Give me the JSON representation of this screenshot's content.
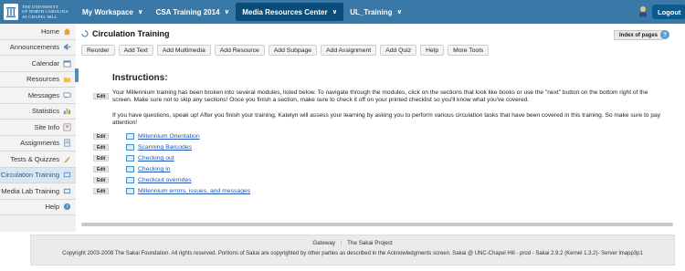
{
  "brand": {
    "line1": "The University",
    "line2": "of North Carolina",
    "line3": "at Chapel Hill"
  },
  "site_tabs": [
    {
      "label": "My Workspace"
    },
    {
      "label": "CSA Training 2014"
    },
    {
      "label": "Media Resources Center"
    },
    {
      "label": "UL_Training"
    }
  ],
  "logout_label": "Logout",
  "sidebar": {
    "items": [
      {
        "label": "Home",
        "icon": "home-icon"
      },
      {
        "label": "Announcements",
        "icon": "announcements-icon"
      },
      {
        "label": "Calendar",
        "icon": "calendar-icon"
      },
      {
        "label": "Resources",
        "icon": "folder-icon"
      },
      {
        "label": "Messages",
        "icon": "messages-icon"
      },
      {
        "label": "Statistics",
        "icon": "statistics-icon"
      },
      {
        "label": "Site Info",
        "icon": "site-info-icon"
      },
      {
        "label": "Assignments",
        "icon": "assignments-icon"
      },
      {
        "label": "Tests & Quizzes",
        "icon": "pencil-icon"
      },
      {
        "label": "Circulation Training",
        "icon": "book-icon"
      },
      {
        "label": "Media Lab Training",
        "icon": "book-icon"
      },
      {
        "label": "Help",
        "icon": "help-icon"
      }
    ]
  },
  "main": {
    "title": "Circulation Training",
    "index_label": "Index of pages",
    "help_symbol": "?",
    "toolbar": [
      "Reorder",
      "Add Text",
      "Add Multimedia",
      "Add Resource",
      "Add Subpage",
      "Add Assignment",
      "Add Quiz",
      "Help",
      "More Tools"
    ],
    "edit_label": "Edit",
    "instructions_title": "Instructions:",
    "para1": "Your Millennium training has been broken into several modules, listed below. To navigate through the modules, click on the sections that look like books or use the \"next\" button on the bottom right of the screen. Make sure not to skip any sections! Once you finish a section, make sure to check it off on your printed checklist so you'll know what you've covered.",
    "para2": "If you have questions, speak up! After you finish your training, Katelyn will assess your learning by asking you to perform various circulation tasks that have been covered in this training. So make sure to pay attention!",
    "modules": [
      "Millennium Orientation",
      "Scanning Barcodes",
      "Checking out",
      "Checking in",
      "Checkout overrides",
      "Millennium errors, issues, and messages"
    ]
  },
  "footer": {
    "links": [
      "Gateway",
      "The Sakai Project"
    ],
    "copyright": "Copyright 2003-2008 The Sakai Foundation. All rights reserved. Portions of Sakai are copyrighted by other parties as described in the Acknowledgments screen. Sakai @ UNC-Chapel Hill - prod - Sakai 2.9.2 (Kernel 1.3.2)- Server lmapp3p1"
  },
  "colors": {
    "topbar": "#3a78a8",
    "active_site_tab": "#0a4d7a",
    "link": "#1f56b5"
  }
}
